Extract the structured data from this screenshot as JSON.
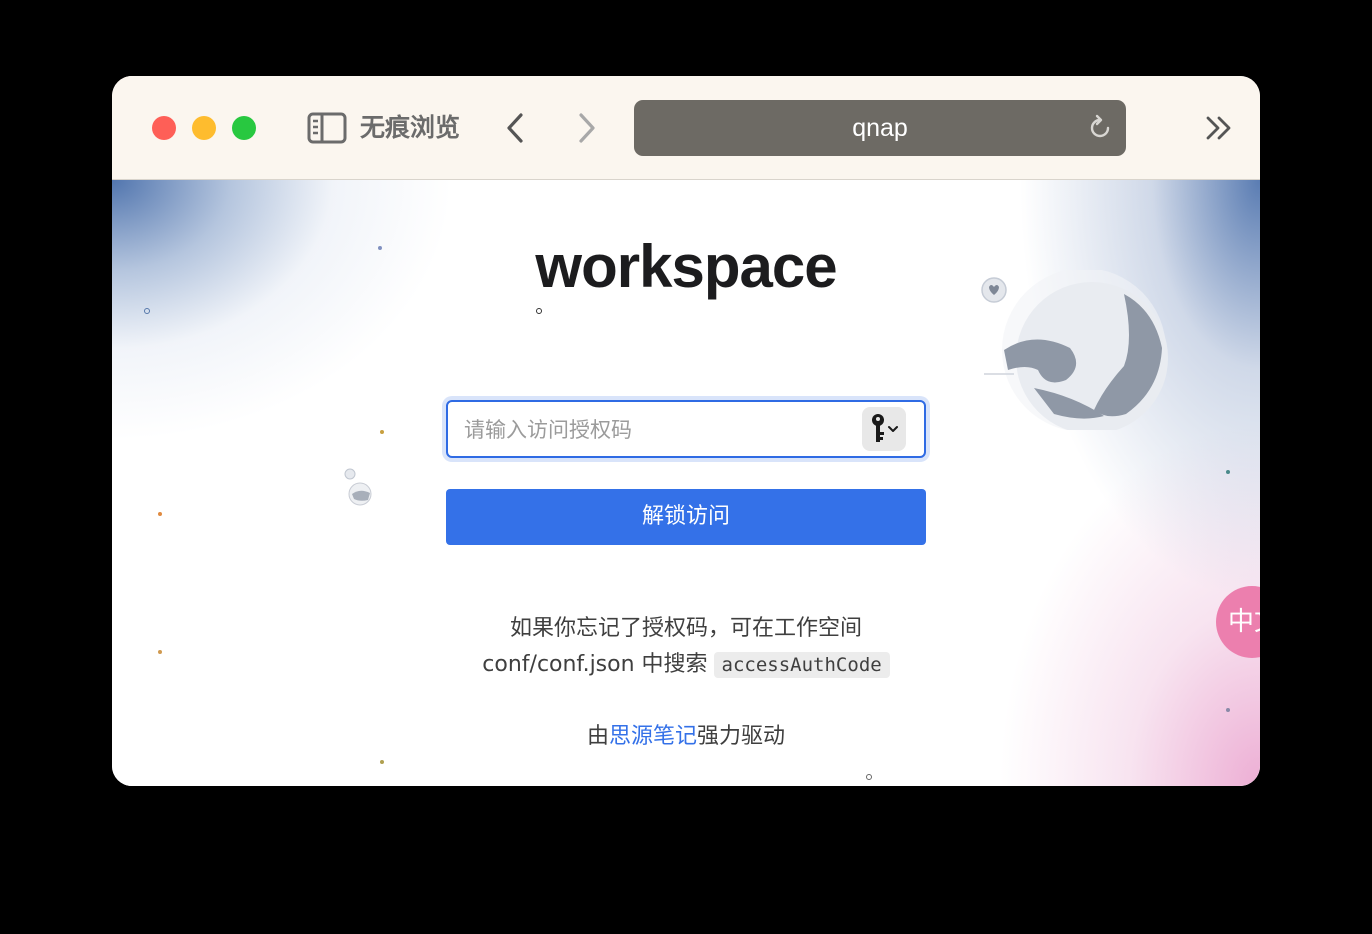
{
  "browser": {
    "private_label": "无痕浏览",
    "address": "qnap"
  },
  "page": {
    "brand": "workspace",
    "input_placeholder": "请输入访问授权码",
    "unlock_button": "解锁访问",
    "hint_line1": "如果你忘记了授权码，可在工作空间",
    "hint_line2_prefix": "conf/conf.json 中搜索",
    "hint_code": "accessAuthCode",
    "powered_prefix": "由",
    "powered_link": "思源笔记",
    "powered_suffix": "强力驱动",
    "lang_toggle": "中文"
  },
  "colors": {
    "accent": "#3471e8",
    "toolbar_bg": "#fbf6ef",
    "address_bg": "#6d6a64",
    "lang_btn": "#ec7fae"
  },
  "icons": {
    "sidebar": "sidebar-icon",
    "back": "chevron-left-icon",
    "forward": "chevron-right-icon",
    "reload": "reload-icon",
    "more": "double-chevron-right-icon",
    "password": "key-icon"
  }
}
